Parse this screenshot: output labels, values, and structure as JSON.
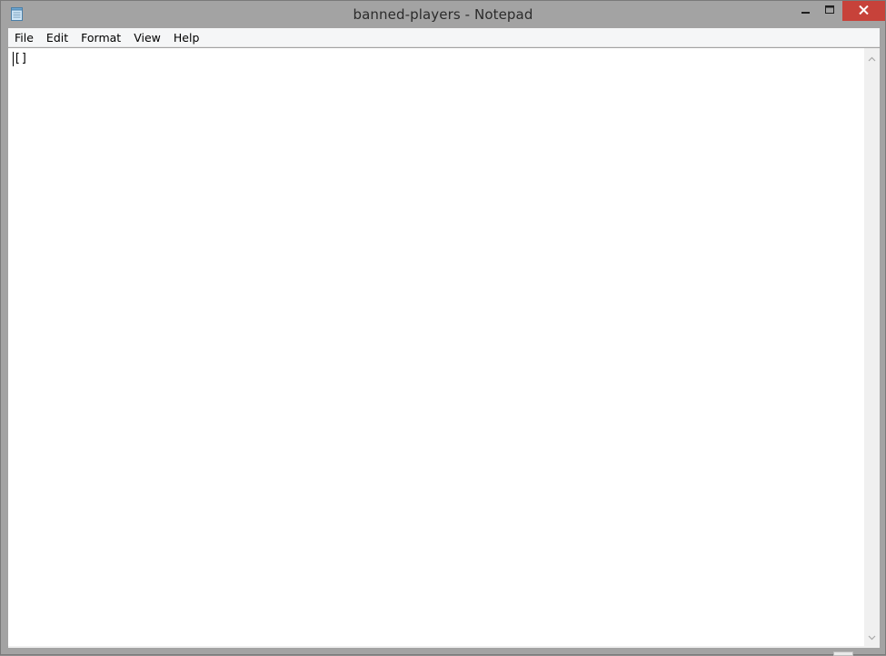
{
  "window": {
    "title": "banned-players - Notepad"
  },
  "menu": {
    "items": [
      {
        "label": "File"
      },
      {
        "label": "Edit"
      },
      {
        "label": "Format"
      },
      {
        "label": "View"
      },
      {
        "label": "Help"
      }
    ]
  },
  "editor": {
    "content": "[]"
  },
  "icons": {
    "app": "notepad-icon",
    "minimize": "minimize-icon",
    "maximize": "maximize-icon",
    "close": "close-icon",
    "scroll_up": "chevron-up-icon",
    "scroll_down": "chevron-down-icon"
  },
  "colors": {
    "close_button": "#c7423a",
    "titlebar": "#a3a3a3",
    "menubar": "#f5f6f7",
    "editor_bg": "#ffffff"
  }
}
